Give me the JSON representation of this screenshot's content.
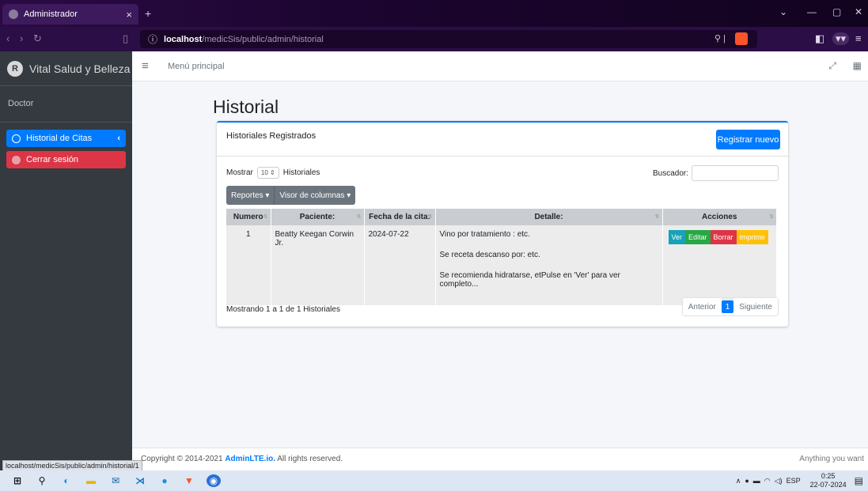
{
  "browser": {
    "tab_title": "Administrador",
    "tab_close": "×",
    "new_tab": "+",
    "url_host": "localhost",
    "url_path": "/medicSis/public/admin/historial",
    "status_url": "localhost/medicSis/public/admin/historial/1"
  },
  "sidebar": {
    "brand": "Vital Salud y Belleza",
    "user": "Doctor",
    "items": [
      {
        "label": "Historial de Citas",
        "chevron": "‹"
      },
      {
        "label": "Cerrar sesión"
      }
    ]
  },
  "topnav": {
    "menu_label": "Menú principal"
  },
  "page": {
    "title": "Historial"
  },
  "card": {
    "title": "Historiales Registrados",
    "register_button": "Registrar nuevo",
    "show_label": "Mostrar",
    "show_value": "10",
    "show_suffix": "Historiales",
    "search_label": "Buscador:",
    "reportes_button": "Reportes",
    "columns_button": "Visor de columnas"
  },
  "table": {
    "headers": [
      "Numero",
      "Paciente:",
      "Fecha de la cita:",
      "Detalle:",
      "Acciones"
    ],
    "rows": [
      {
        "numero": "1",
        "paciente": "Beatty Keegan Corwin Jr.",
        "fecha": "2024-07-22",
        "detalle": [
          "Vino por tratamiento : etc.",
          "Se receta descanso por: etc.",
          "Se recomienda hidratarse, etPulse en 'Ver' para ver completo..."
        ]
      }
    ],
    "actions": {
      "ver": "Ver",
      "editar": "Editar",
      "borrar": "Borrar",
      "imprimir": "Imprimir"
    },
    "action_colors": {
      "ver": "#17a2b8",
      "editar": "#28a745",
      "borrar": "#dc3545",
      "imprimir": "#ffc107"
    }
  },
  "pagination": {
    "info": "Mostrando 1 a 1 de 1 Historiales",
    "prev": "Anterior",
    "current": "1",
    "next": "Siguiente"
  },
  "footer": {
    "copyright_prefix": "Copyright © 2014-2021 ",
    "copyright_brand": "AdminLTE.io.",
    "copyright_suffix": " All rights reserved.",
    "right_text": "Anything you want"
  },
  "taskbar": {
    "language": "ESP",
    "time": "0:25",
    "date": "22-07-2024"
  }
}
